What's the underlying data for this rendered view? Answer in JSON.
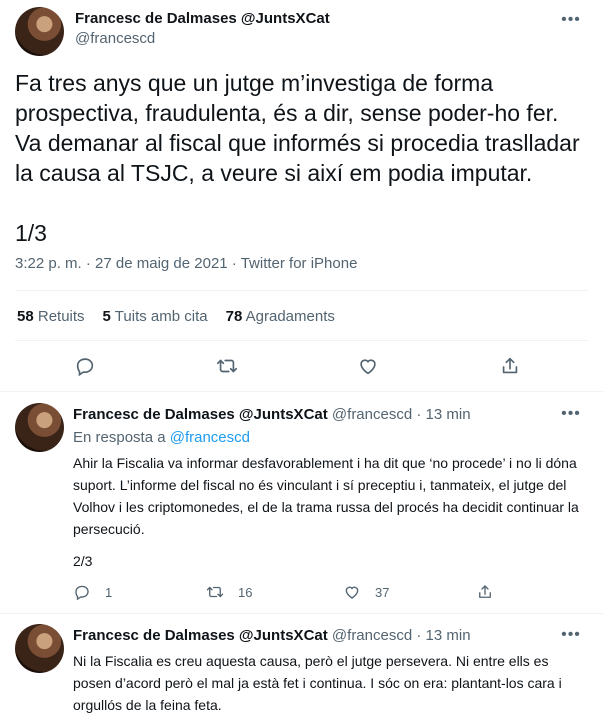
{
  "main_tweet": {
    "author_name": "Francesc de Dalmases @JuntsXCat",
    "author_handle": "@francescd",
    "text": "Fa tres anys que un jutge m’investiga de forma prospectiva, fraudulenta, és a dir, sense poder-ho fer. Va demanar al fiscal que informés si procedia traslladar la causa al TSJC, a veure si així em podia imputar.\n\n1/3",
    "meta": "3:22 p. m. · 27 de maig de 2021 · Twitter for iPhone",
    "stats": {
      "retweets_count": "58",
      "retweets_label": "Retuits",
      "quotes_count": "5",
      "quotes_label": "Tuits amb cita",
      "likes_count": "78",
      "likes_label": "Agradaments"
    }
  },
  "reply_1": {
    "author_name": "Francesc de Dalmases @JuntsXCat",
    "author_handle": "@francescd",
    "time": "· 13 min",
    "replying_prefix": "En resposta a",
    "replying_to": "@francescd",
    "text": "Ahir la Fiscalia va informar desfavorablement i ha dit que ‘no procede’ i no li dóna suport. L’informe del fiscal no és vinculant i sí preceptiu i, tanmateix, el jutge del Volhov i les criptomonedes, el de la trama russa del procés ha decidit continuar la persecució.",
    "thread_index": "2/3",
    "reply_count": "1",
    "retweet_count": "16",
    "like_count": "37"
  },
  "reply_2": {
    "author_name": "Francesc de Dalmases @JuntsXCat",
    "author_handle": "@francescd",
    "time": "· 13 min",
    "text": "Ni la Fiscalia es creu aquesta causa, però el jutge persevera. Ni entre ells es posen d’acord però el mal ja està fet i continua. I sóc on era: plantant-los cara i orgullós de la feina feta."
  },
  "icons": [
    "more-icon",
    "reply-icon",
    "retweet-icon",
    "like-icon",
    "share-icon"
  ],
  "colors": {
    "link": "#1d9bf0",
    "muted": "#536471",
    "text": "#0f1419",
    "divider": "#eff3f4"
  }
}
